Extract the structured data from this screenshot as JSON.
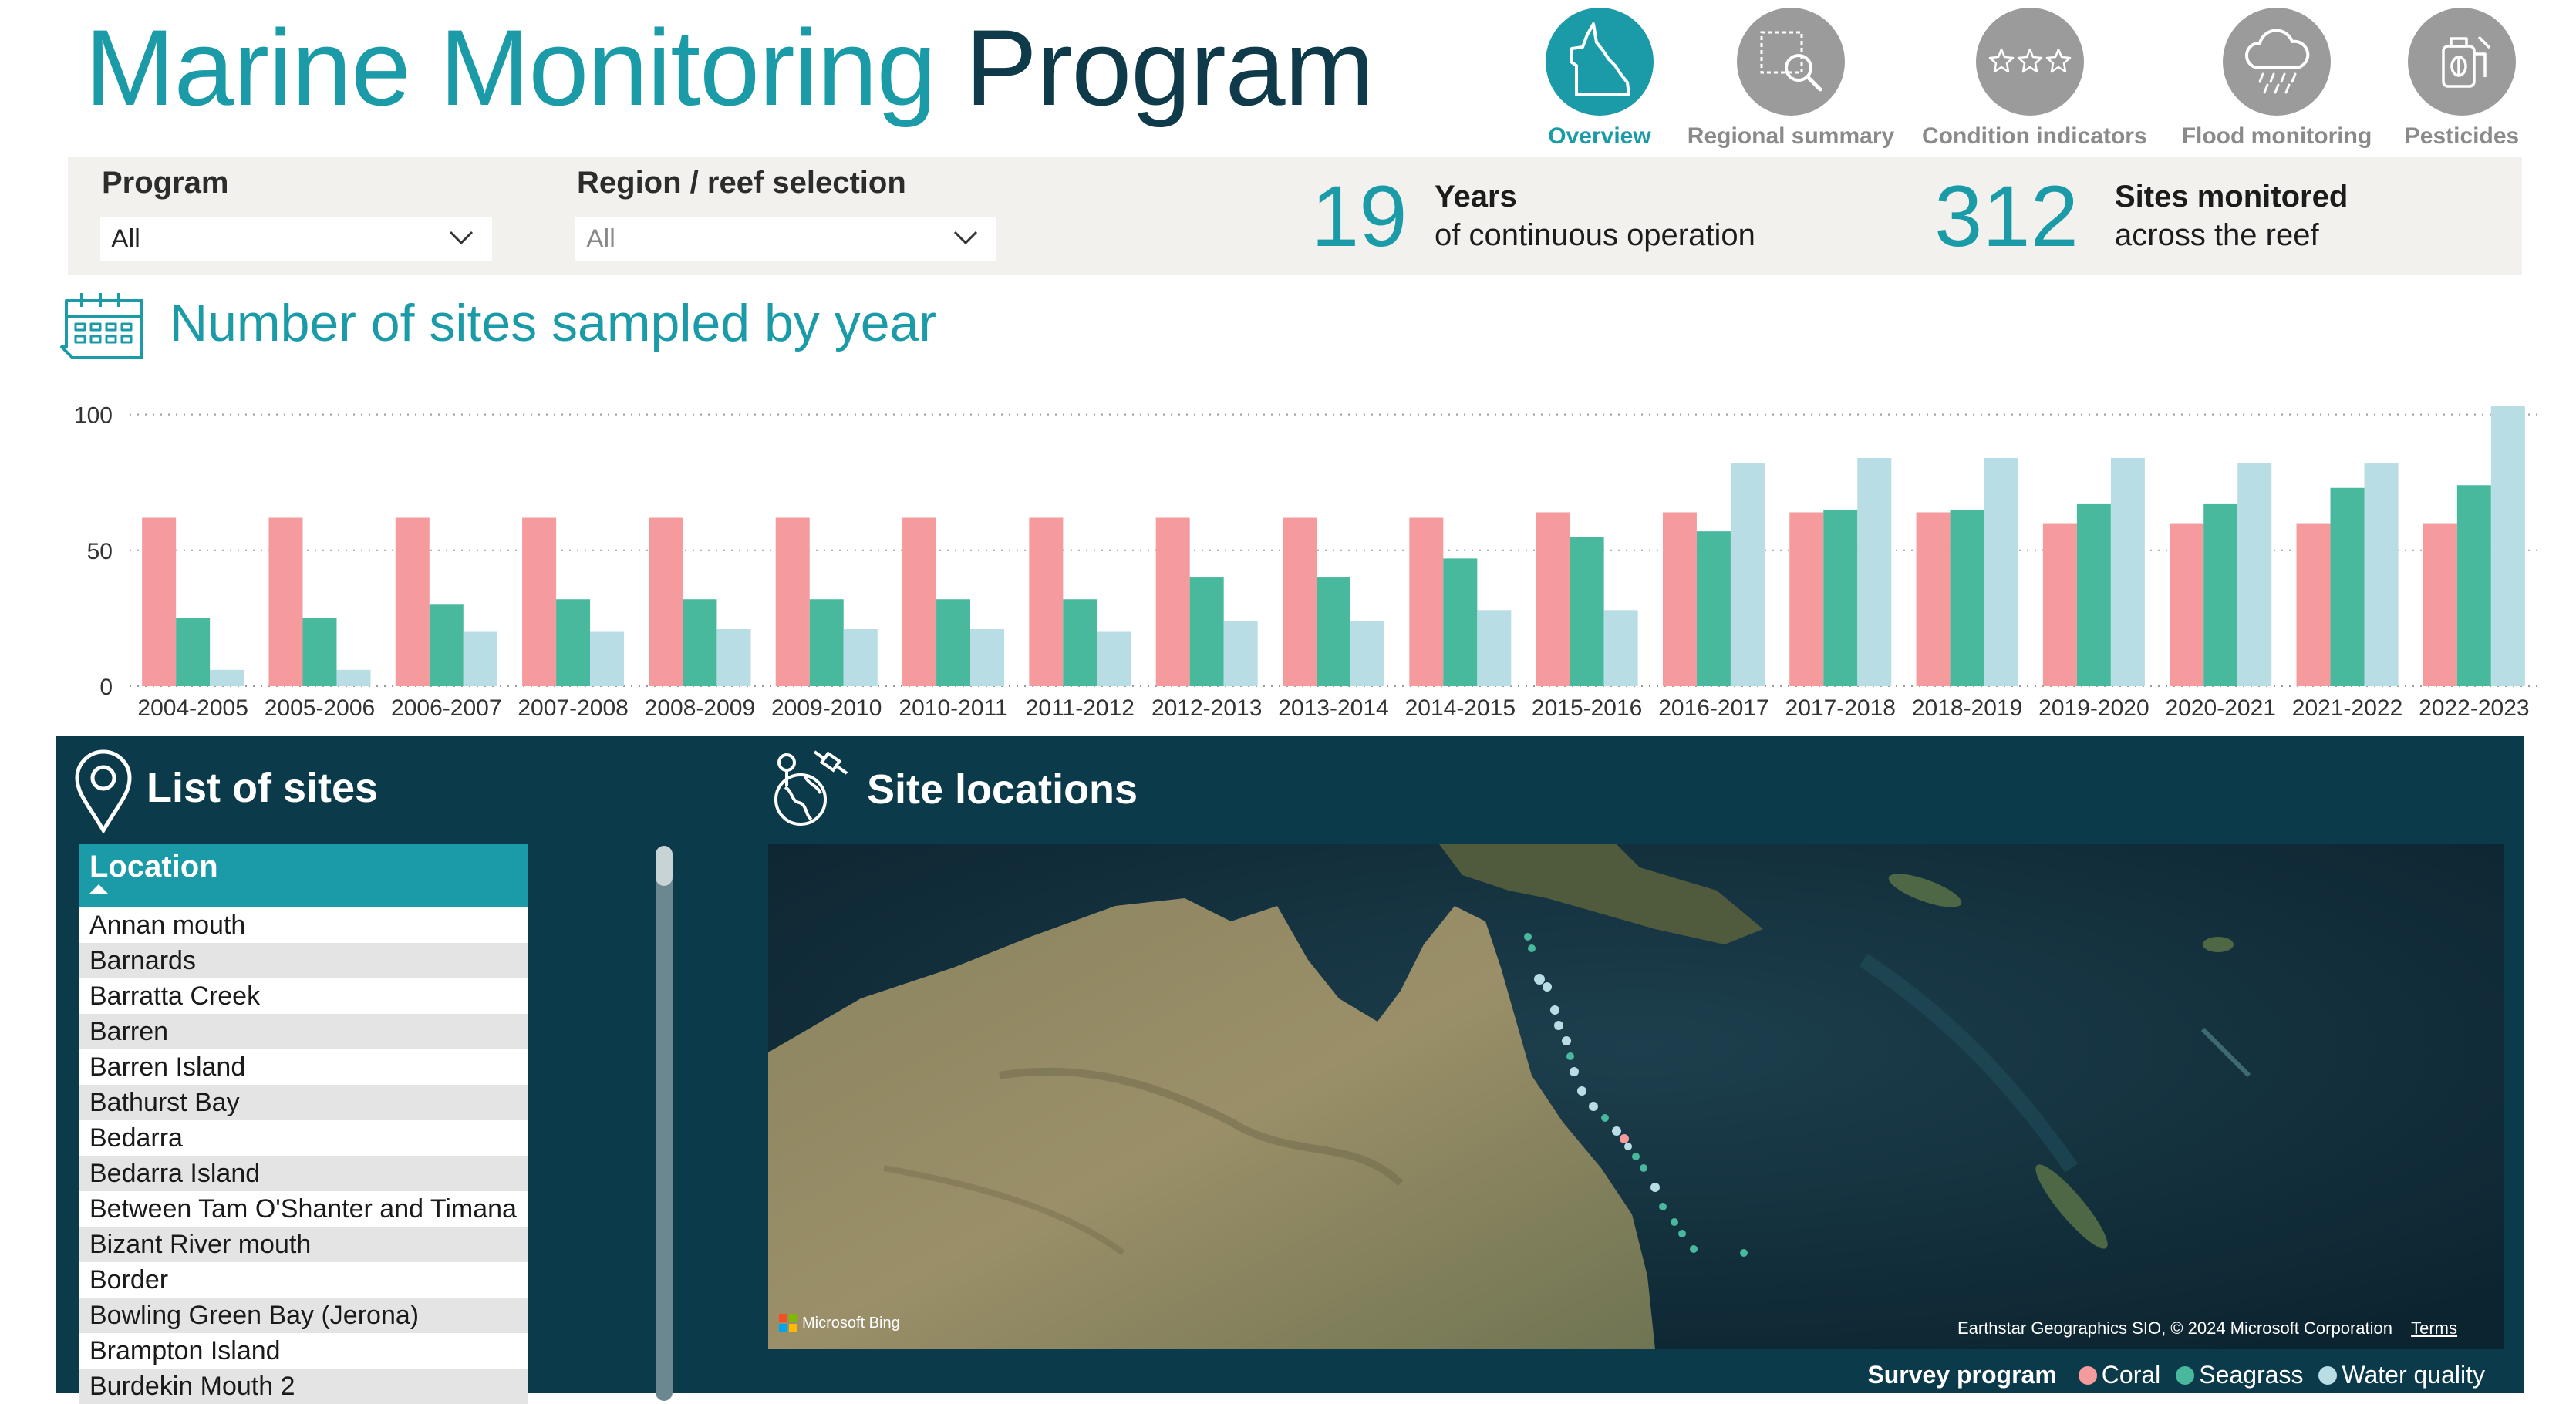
{
  "header": {
    "title_part1": "Marine Monitoring",
    "title_part2": "Program"
  },
  "nav": {
    "items": [
      {
        "label": "Overview",
        "icon": "queensland-map-icon",
        "active": true
      },
      {
        "label": "Regional summary",
        "icon": "region-search-icon",
        "active": false
      },
      {
        "label": "Condition indicators",
        "icon": "stars-icon",
        "active": false
      },
      {
        "label": "Flood monitoring",
        "icon": "rain-cloud-icon",
        "active": false
      },
      {
        "label": "Pesticides",
        "icon": "pesticide-sprayer-icon",
        "active": false
      }
    ]
  },
  "filters": {
    "program_label": "Program",
    "program_value": "All",
    "region_label": "Region / reef selection",
    "region_value": "All"
  },
  "kpis": {
    "years": {
      "value": "19",
      "line1": "Years",
      "line2": "of continuous operation"
    },
    "sites": {
      "value": "312",
      "line1": "Sites monitored",
      "line2": "across the reef"
    }
  },
  "chart_section": {
    "title": "Number of sites sampled by year",
    "icon": "calendar-icon"
  },
  "chart_data": {
    "type": "bar",
    "title": "Number of sites sampled by year",
    "categories": [
      "2004-2005",
      "2005-2006",
      "2006-2007",
      "2007-2008",
      "2008-2009",
      "2009-2010",
      "2010-2011",
      "2011-2012",
      "2012-2013",
      "2013-2014",
      "2014-2015",
      "2015-2016",
      "2016-2017",
      "2017-2018",
      "2018-2019",
      "2019-2020",
      "2020-2021",
      "2021-2022",
      "2022-2023"
    ],
    "series": [
      {
        "name": "Coral",
        "color": "#f59b9e",
        "values": [
          62,
          62,
          62,
          62,
          62,
          62,
          62,
          62,
          62,
          62,
          62,
          64,
          64,
          64,
          64,
          60,
          60,
          60,
          60
        ]
      },
      {
        "name": "Seagrass",
        "color": "#48b99c",
        "values": [
          25,
          25,
          30,
          32,
          32,
          32,
          32,
          32,
          40,
          40,
          47,
          55,
          57,
          65,
          65,
          67,
          67,
          73,
          74
        ]
      },
      {
        "name": "Water quality",
        "color": "#b8dde4",
        "values": [
          6,
          6,
          20,
          20,
          21,
          21,
          21,
          20,
          24,
          24,
          28,
          28,
          82,
          84,
          84,
          84,
          82,
          82,
          103
        ]
      }
    ],
    "yticks": [
      0,
      50,
      100
    ],
    "ylim": [
      0,
      105
    ],
    "grid": true,
    "xlabel": "",
    "ylabel": ""
  },
  "sites_panel": {
    "title": "List of sites",
    "icon": "location-pin-icon",
    "column_header": "Location",
    "rows": [
      "Annan mouth",
      "Barnards",
      "Barratta Creek",
      "Barren",
      "Barren Island",
      "Bathurst Bay",
      "Bedarra",
      "Bedarra Island",
      "Between Tam O'Shanter and Timana",
      "Bizant River mouth",
      "Border",
      "Bowling Green Bay (Jerona)",
      "Brampton Island",
      "Burdekin Mouth 2"
    ]
  },
  "map_panel": {
    "title": "Site locations",
    "icon": "satellite-globe-icon",
    "bing_label": "Microsoft Bing",
    "credit": "Earthstar Geographics SIO, © 2024 Microsoft Corporation",
    "terms": "Terms"
  },
  "legend": {
    "title": "Survey program",
    "items": [
      {
        "label": "Coral",
        "color": "#f59b9e"
      },
      {
        "label": "Seagrass",
        "color": "#48b99c"
      },
      {
        "label": "Water quality",
        "color": "#b8dde4"
      }
    ]
  }
}
